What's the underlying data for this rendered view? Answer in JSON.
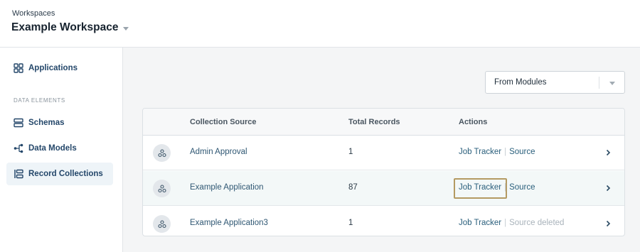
{
  "workspace": {
    "label": "Workspaces",
    "name": "Example Workspace"
  },
  "sidebar": {
    "items": [
      {
        "label": "Applications",
        "icon": "grid-icon"
      },
      {
        "label": "Schemas",
        "icon": "schema-icon"
      },
      {
        "label": "Data Models",
        "icon": "data-model-icon"
      },
      {
        "label": "Record Collections",
        "icon": "collection-icon",
        "active": true
      }
    ],
    "section_label": "DATA ELEMENTS"
  },
  "filter": {
    "selected": "From Modules"
  },
  "table": {
    "headers": [
      "Collection Source",
      "Total Records",
      "Actions"
    ],
    "rows": [
      {
        "source": "Admin Approval",
        "records": "1",
        "action_primary": "Job Tracker",
        "action_secondary": "Source",
        "secondary_muted": false
      },
      {
        "source": "Example Application",
        "records": "87",
        "action_primary": "Job Tracker",
        "action_secondary": "Source",
        "secondary_muted": false,
        "highlighted": true
      },
      {
        "source": "Example Application3",
        "records": "1",
        "action_primary": "Job Tracker",
        "action_secondary": "Source deleted",
        "secondary_muted": true
      }
    ]
  },
  "colors": {
    "accent": "#2a5f7c",
    "highlight_box": "#b49a62",
    "active_nav_bg": "#eef4f8"
  }
}
